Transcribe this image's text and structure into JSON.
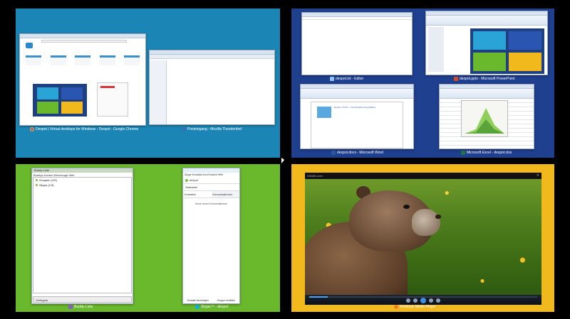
{
  "desktops": {
    "d1": {
      "bg": "#1b86b6",
      "browser_caption": "Dexpot | Virtual desktops for Windows - Dexpot - Google Chrome",
      "thunderbird_caption": "Posteingang - Mozilla Thunderbird"
    },
    "d2": {
      "bg": "#1f3f8f",
      "editor_caption": "dexpot.txt - Editor",
      "ppt_caption": "dexpot.pptx - Microsoft PowerPoint",
      "word_caption": "dexpot.docx - Microsoft Word",
      "excel_caption": "Microsoft Excel - dexpot.xlsx",
      "word_heading": "Dexpot 1.6 Pro - Lizenzbestimmung (Miete)"
    },
    "d3": {
      "bg": "#6ab82c",
      "buddy_caption": "Buddy-Liste",
      "buddy_title": "Buddy-Liste",
      "buddy_menu": "Buddys  Konten  Werkzeuge  Hilfe",
      "buddy_groups": [
        "Gruppen (1/5)",
        "Skype (1/3)"
      ],
      "buddy_status": "Verfügbar",
      "skype_caption": "Skype™ - dexpot",
      "skype_menu": "Skype  Kontakte  Anruf  Ansicht  Hilfe",
      "skype_user": "dexpot",
      "skype_tab_contacts": "Kontakte",
      "skype_tab_conversations": "Konversationen",
      "skype_item_startseite": "Startseite",
      "skype_empty": "Keine neuen Konversationen",
      "skype_add": "Kontakt hinzufügen",
      "skype_group": "Gruppe erstellen"
    },
    "d4": {
      "bg": "#f2b91c",
      "player_caption": "Windows Media Player",
      "player_title": "Wildlife.wmv",
      "progress": 0.08
    }
  }
}
